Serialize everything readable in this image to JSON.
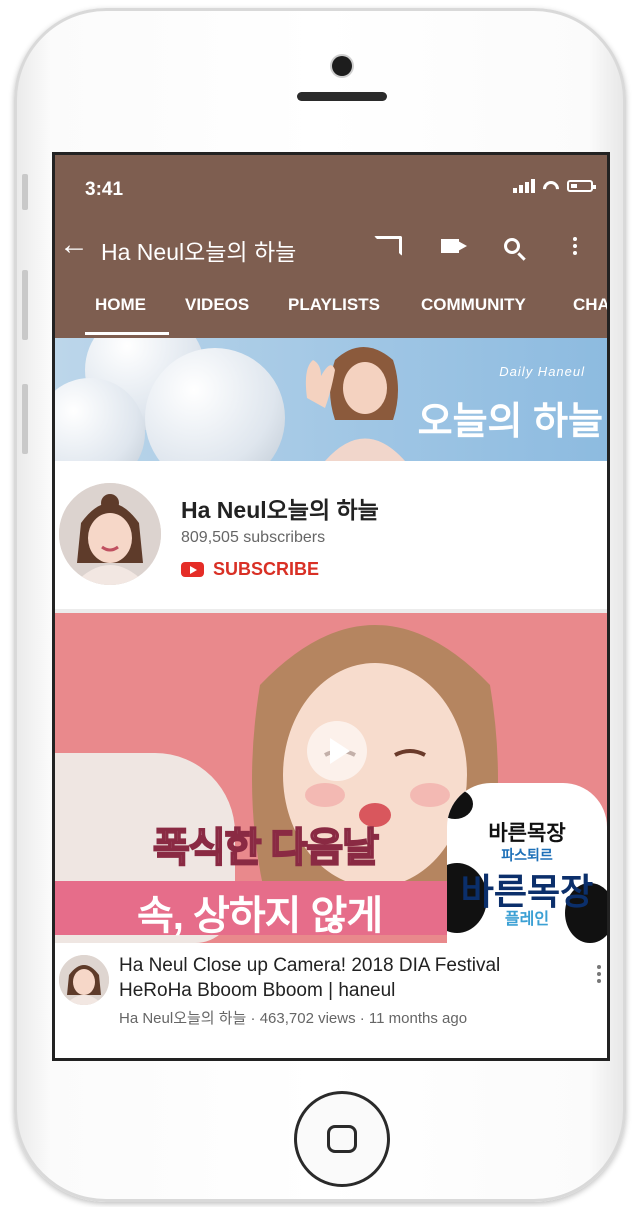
{
  "status": {
    "time": "3:41"
  },
  "appbar": {
    "channel_title": "Ha Neul오늘의 하늘"
  },
  "tabs": [
    "HOME",
    "VIDEOS",
    "PLAYLISTS",
    "COMMUNITY",
    "CHA"
  ],
  "banner": {
    "small_text": "Daily Haneul",
    "big_text": "오늘의 하늘"
  },
  "channel": {
    "name": "Ha Neul오늘의 하늘",
    "subscribers": "809,505 subscribers",
    "subscribe_label": "SUBSCRIBE"
  },
  "video": {
    "caption_line1": "폭식한 다음날",
    "caption_line2": "속, 상하지 않게",
    "product": {
      "line1": "바른목장",
      "line2": "파스퇴르",
      "line3": "바른목장",
      "line4": "플레인"
    },
    "title_line1": "Ha Neul Close up Camera! 2018 DIA Festival",
    "title_line2": "HeRoHa Bboom Bboom  |  haneul",
    "meta": "Ha Neul오늘의 하늘 · 463,702 views · 11 months ago"
  },
  "colors": {
    "header_bg": "#7e5e50",
    "subscribe_red": "#d93025",
    "thumbnail_pink": "#e9898c"
  }
}
